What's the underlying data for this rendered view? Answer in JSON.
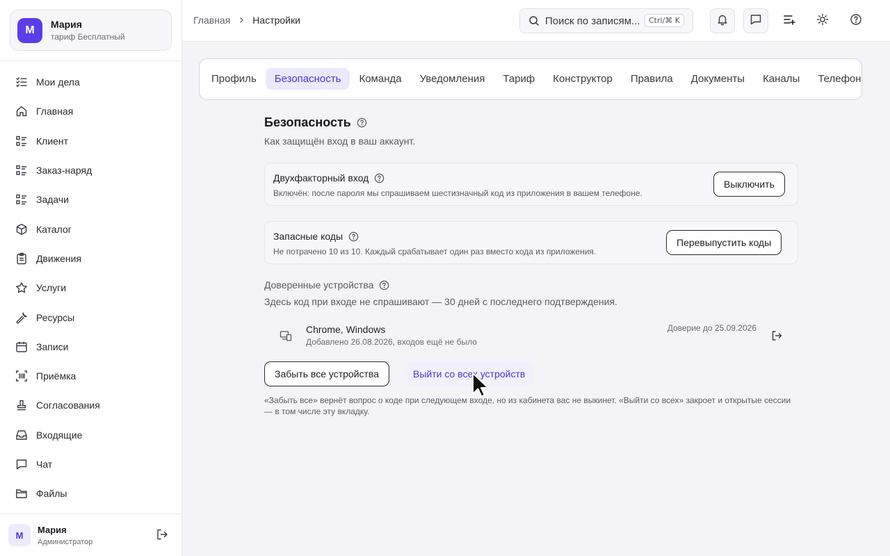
{
  "account": {
    "avatar_letter": "М",
    "name": "Мария",
    "plan": "тариф Бесплатный"
  },
  "sidebar": {
    "items": [
      {
        "label": "Мои дела",
        "icon": "checklist-icon"
      },
      {
        "label": "Главная",
        "icon": "home-icon"
      },
      {
        "label": "Клиент",
        "icon": "list-icon"
      },
      {
        "label": "Заказ-наряд",
        "icon": "list-icon"
      },
      {
        "label": "Задачи",
        "icon": "list-icon"
      },
      {
        "label": "Каталог",
        "icon": "box-icon"
      },
      {
        "label": "Движения",
        "icon": "clipboard-icon"
      },
      {
        "label": "Услуги",
        "icon": "star-icon"
      },
      {
        "label": "Ресурсы",
        "icon": "wrench-icon"
      },
      {
        "label": "Записи",
        "icon": "calendar-icon"
      },
      {
        "label": "Приёмка",
        "icon": "barcode-icon"
      },
      {
        "label": "Согласования",
        "icon": "stamp-icon"
      },
      {
        "label": "Входящие",
        "icon": "inbox-icon"
      },
      {
        "label": "Чат",
        "icon": "chat-icon"
      },
      {
        "label": "Файлы",
        "icon": "folder-icon"
      }
    ]
  },
  "user": {
    "avatar_letter": "М",
    "name": "Мария",
    "role": "Администратор"
  },
  "breadcrumb": {
    "home": "Главная",
    "current": "Настройки"
  },
  "search": {
    "placeholder": "Поиск по записям...",
    "shortcut": "Ctrl/⌘ K"
  },
  "tabs": [
    "Профиль",
    "Безопасность",
    "Команда",
    "Уведомления",
    "Тариф",
    "Конструктор",
    "Правила",
    "Документы",
    "Каналы",
    "Телефония"
  ],
  "active_tab": "Безопасность",
  "security": {
    "title": "Безопасность",
    "subtitle": "Как защищён вход в ваш аккаунт.",
    "two_factor": {
      "title": "Двухфакторный вход",
      "description": "Включён: после пароля мы спрашиваем шестизначный код из приложения в вашем телефоне.",
      "button": "Выключить"
    },
    "backup_codes": {
      "title": "Запасные коды",
      "description": "Не потрачено 10 из 10. Каждый срабатывает один раз вместо кода из приложения.",
      "button": "Перевыпустить коды"
    },
    "trusted": {
      "title": "Доверенные устройства",
      "description": "Здесь код при входе не спрашивают — 30 дней с последнего подтверждения.",
      "device": {
        "name": "Chrome, Windows",
        "meta": "Добавлено 26.08.2026, входов ещё не было",
        "trust": "Доверие до 25.09.2026"
      },
      "forget_all": "Забыть все устройства",
      "sign_out_all": "Выйти со всех устройств",
      "footnote": "«Забыть все» вернёт вопрос о коде при следующем входе, но из кабинета вас не выкинет. «Выйти со всех» закроет и открытые сессии — в том числе эту вкладку."
    }
  },
  "colors": {
    "accent": "#4a38d0",
    "avatar": "#5b3ee8",
    "active_tab_bg": "#ebe9fb"
  }
}
